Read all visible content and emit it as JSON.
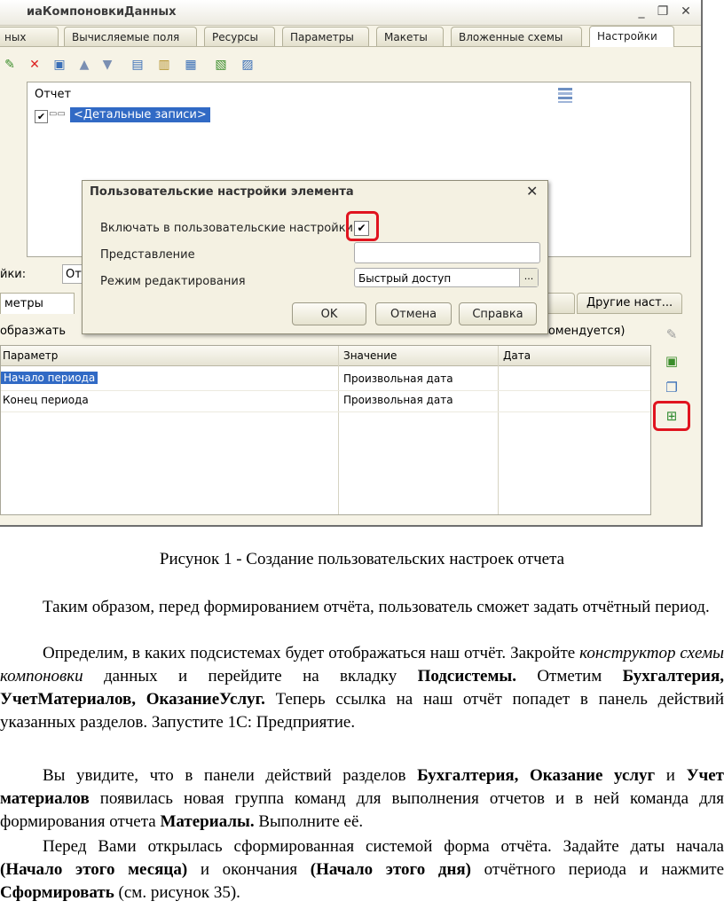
{
  "window": {
    "title": "иаКомпоновкиДанных",
    "controls": [
      "_",
      "❐",
      "✕"
    ]
  },
  "tabs": [
    "ных",
    "Вычисляемые поля",
    "Ресурсы",
    "Параметры",
    "Макеты",
    "Вложенные схемы",
    "Настройки"
  ],
  "active_tab": "Настройки",
  "tree": {
    "root": "Отчет",
    "child": "<Детальные записи>"
  },
  "lower": {
    "settings_label": "йки:",
    "settings_value": "От",
    "params_tab": "метры",
    "other_tab": "Другие наст...",
    "show_text": "образжать",
    "recommend_text": "екомендуется)"
  },
  "grid": {
    "columns": [
      "Параметр",
      "Значение",
      "Дата"
    ],
    "rows": [
      {
        "param": "Начало периода",
        "value": "Произвольная дата",
        "date": ""
      },
      {
        "param": "Конец периода",
        "value": "Произвольная дата",
        "date": ""
      }
    ]
  },
  "dialog": {
    "title": "Пользовательские настройки элемента",
    "include_label": "Включать в пользовательские настройки",
    "include_checked": true,
    "presentation_label": "Представление",
    "presentation_value": "",
    "mode_label": "Режим редактирования",
    "mode_value": "Быстрый доступ",
    "ok": "OK",
    "cancel": "Отмена",
    "help": "Справка"
  },
  "document": {
    "caption": "Рисунок 1 - Создание пользовательских настроек отчета",
    "p1": "Таким образом, перед формированием отчёта, пользователь сможет задать отчётный период.",
    "p2": [
      {
        "t": "Определим, в каких подсистемах будет отображаться наш отчёт. Закройте ",
        "s": ""
      },
      {
        "t": "конструктор схемы компоновки",
        "s": "i"
      },
      {
        "t": " данных и перейдите на вкладку ",
        "s": ""
      },
      {
        "t": "Подсистемы.",
        "s": "b"
      },
      {
        "t": " Отметим ",
        "s": ""
      },
      {
        "t": "Бухгалтерия, УчетМатериалов, ОказаниеУслуг.",
        "s": "b"
      },
      {
        "t": " Теперь ссылка на наш отчёт попадет в панель действий указанных разделов. Запустите 1С: Предприятие.",
        "s": ""
      }
    ],
    "p3": [
      {
        "t": "Вы увидите, что в панели действий разделов ",
        "s": ""
      },
      {
        "t": "Бухгалтерия, Оказание услуг",
        "s": "b"
      },
      {
        "t": " и ",
        "s": ""
      },
      {
        "t": "Учет материалов",
        "s": "b"
      },
      {
        "t": " появилась новая группа команд для выполнения отчетов и в ней команда для формирования отчета ",
        "s": ""
      },
      {
        "t": "Материалы.",
        "s": "b"
      },
      {
        "t": " Выполните её.",
        "s": ""
      }
    ],
    "p4": [
      {
        "t": "Перед Вами открылась сформированная системой форма отчёта. Задайте даты начала ",
        "s": ""
      },
      {
        "t": "(Начало этого месяца)",
        "s": "b"
      },
      {
        "t": " и окончания ",
        "s": ""
      },
      {
        "t": "(Начало этого дня)",
        "s": "b"
      },
      {
        "t": " отчётного периода и нажмите ",
        "s": ""
      },
      {
        "t": "Сформировать",
        "s": "b"
      },
      {
        "t": " (см. рисунок 35).",
        "s": ""
      }
    ]
  },
  "colors": {
    "highlight_red": "#e0141f",
    "selection_blue": "#316ac5"
  }
}
